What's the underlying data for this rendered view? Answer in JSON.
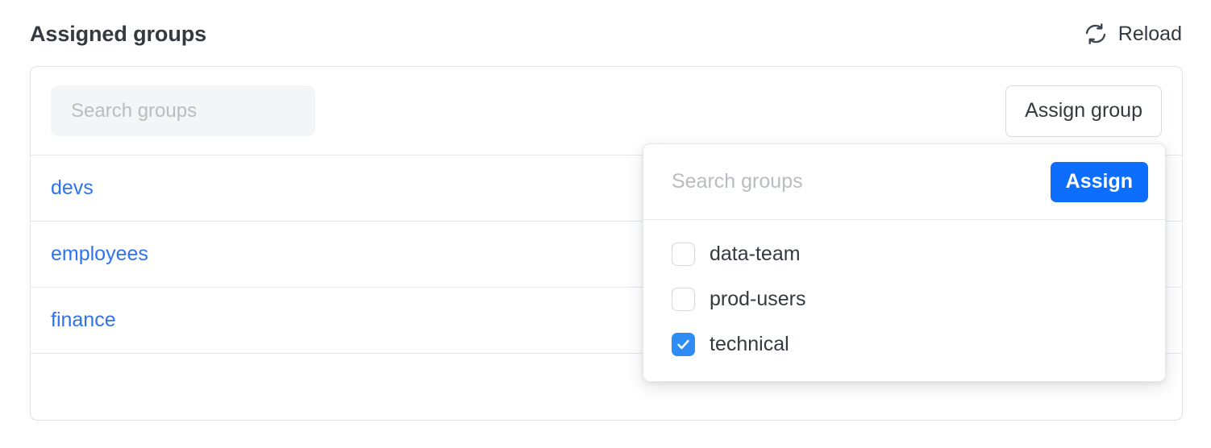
{
  "header": {
    "title": "Assigned groups",
    "reload_label": "Reload",
    "reload_icon": "refresh-icon"
  },
  "card": {
    "search": {
      "placeholder": "Search groups",
      "value": ""
    },
    "assign_group_button": "Assign group",
    "rows": [
      {
        "name": "devs"
      },
      {
        "name": "employees"
      },
      {
        "name": "finance"
      }
    ]
  },
  "assign_popover": {
    "search": {
      "placeholder": "Search groups",
      "value": ""
    },
    "assign_button": "Assign",
    "options": [
      {
        "label": "data-team",
        "checked": false
      },
      {
        "label": "prod-users",
        "checked": false
      },
      {
        "label": "technical",
        "checked": true
      }
    ]
  },
  "colors": {
    "accent_blue": "#0d6efd",
    "checkbox_blue": "#2f8cf5",
    "link_blue": "#2f72f0",
    "text_dark": "#343a40",
    "placeholder_gray": "#b9bcc0",
    "border_gray": "#dee2e6"
  }
}
